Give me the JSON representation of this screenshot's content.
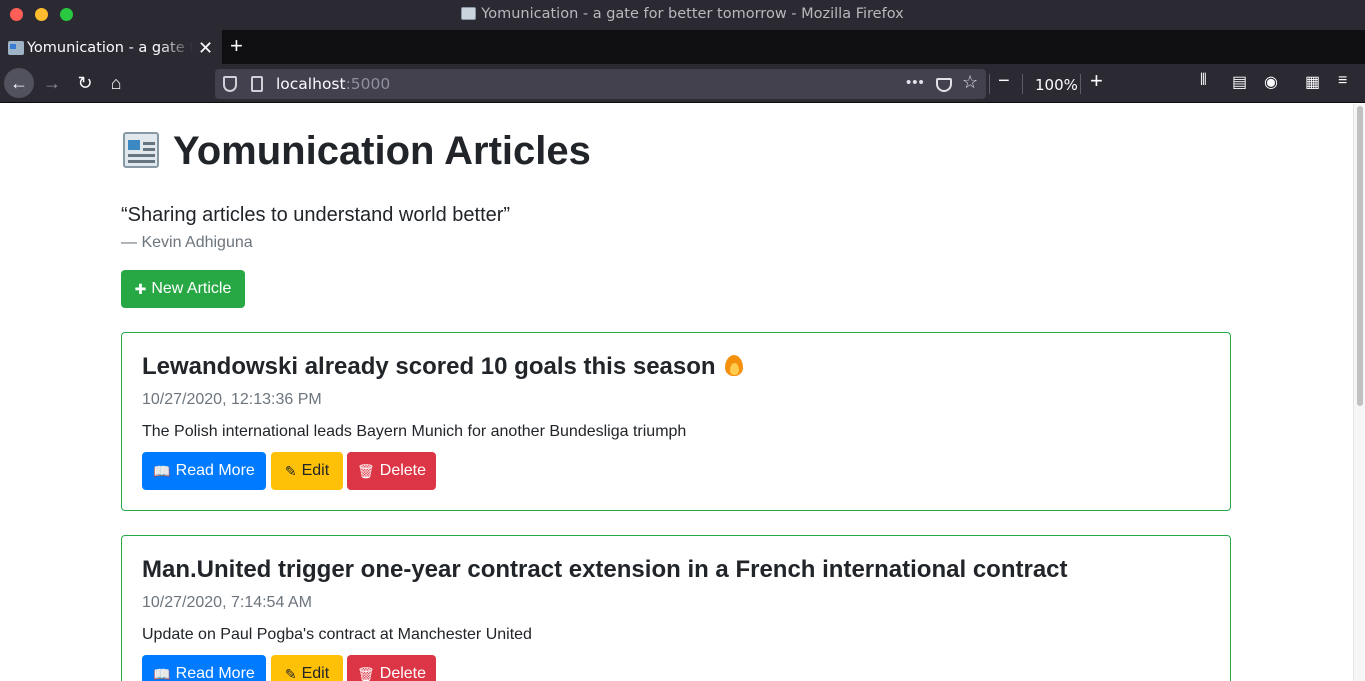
{
  "browser": {
    "window_title": "Yomunication - a gate for better tomorrow - Mozilla Firefox",
    "tab_label": "Yomunication - a gate for better tomorrow",
    "url_host": "localhost",
    "url_port": ":5000",
    "zoom": "100%"
  },
  "page": {
    "title": "Yomunication Articles",
    "quote": "“Sharing articles to understand world better”",
    "quote_author": "— Kevin Adhiguna",
    "new_article_label": "New Article"
  },
  "articles": [
    {
      "title": "Lewandowski already scored 10 goals this season",
      "date": "10/27/2020, 12:13:36 PM",
      "summary": "The Polish international leads Bayern Munich for another Bundesliga triumph",
      "read_label": "Read More",
      "edit_label": "Edit",
      "delete_label": "Delete"
    },
    {
      "title": "Man.United trigger one-year contract extension in a French international contract",
      "date": "10/27/2020, 7:14:54 AM",
      "summary": "Update on Paul Pogba's contract at Manchester United",
      "read_label": "Read More",
      "edit_label": "Edit",
      "delete_label": "Delete"
    }
  ],
  "colors": {
    "success": "#28a745",
    "primary": "#007bff",
    "warning": "#ffc107",
    "danger": "#dc3545"
  }
}
